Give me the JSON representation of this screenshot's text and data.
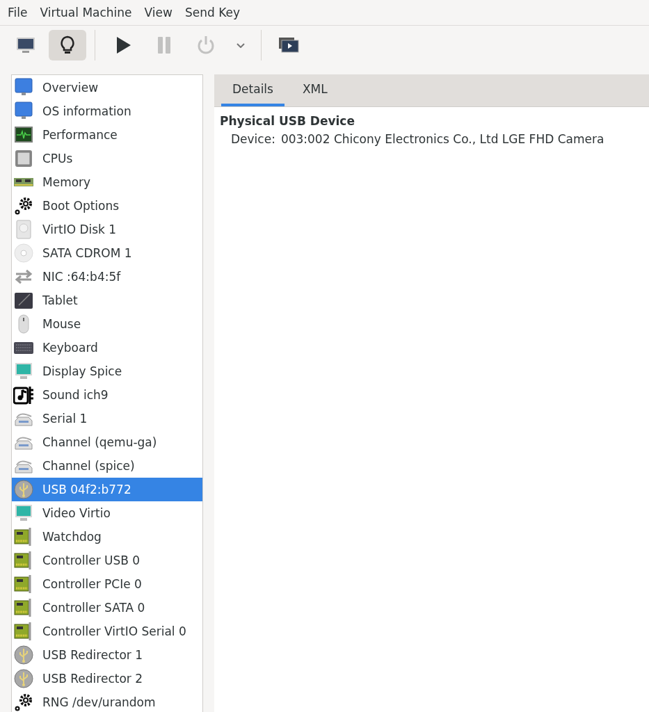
{
  "menu": [
    "File",
    "Virtual Machine",
    "View",
    "Send Key"
  ],
  "toolbar": [
    {
      "kind": "console",
      "selected": false,
      "disabled": false
    },
    {
      "kind": "details",
      "selected": true,
      "disabled": false
    },
    {
      "kind": "separator"
    },
    {
      "kind": "run",
      "selected": false,
      "disabled": false
    },
    {
      "kind": "pause",
      "selected": false,
      "disabled": true
    },
    {
      "kind": "shutdown",
      "selected": false,
      "disabled": true
    },
    {
      "kind": "dropdown",
      "selected": false,
      "disabled": false
    },
    {
      "kind": "separator"
    },
    {
      "kind": "fullscreen",
      "selected": false,
      "disabled": false
    }
  ],
  "sidebar": {
    "items": [
      {
        "label": "Overview",
        "kind": "monitor",
        "selected": false
      },
      {
        "label": "OS information",
        "kind": "monitor",
        "selected": false
      },
      {
        "label": "Performance",
        "kind": "performance",
        "selected": false
      },
      {
        "label": "CPUs",
        "kind": "cpu",
        "selected": false
      },
      {
        "label": "Memory",
        "kind": "memory",
        "selected": false
      },
      {
        "label": "Boot Options",
        "kind": "gears",
        "selected": false
      },
      {
        "label": "VirtIO Disk 1",
        "kind": "disk",
        "selected": false
      },
      {
        "label": "SATA CDROM 1",
        "kind": "cdrom",
        "selected": false
      },
      {
        "label": "NIC :64:b4:5f",
        "kind": "nic",
        "selected": false
      },
      {
        "label": "Tablet",
        "kind": "tablet",
        "selected": false
      },
      {
        "label": "Mouse",
        "kind": "mouse",
        "selected": false
      },
      {
        "label": "Keyboard",
        "kind": "keyboard",
        "selected": false
      },
      {
        "label": "Display Spice",
        "kind": "display",
        "selected": false
      },
      {
        "label": "Sound ich9",
        "kind": "sound",
        "selected": false
      },
      {
        "label": "Serial 1",
        "kind": "serial",
        "selected": false
      },
      {
        "label": "Channel (qemu-ga)",
        "kind": "serial",
        "selected": false
      },
      {
        "label": "Channel (spice)",
        "kind": "serial",
        "selected": false
      },
      {
        "label": "USB 04f2:b772",
        "kind": "usb",
        "selected": true
      },
      {
        "label": "Video Virtio",
        "kind": "display",
        "selected": false
      },
      {
        "label": "Watchdog",
        "kind": "card",
        "selected": false
      },
      {
        "label": "Controller USB 0",
        "kind": "card",
        "selected": false
      },
      {
        "label": "Controller PCIe 0",
        "kind": "card",
        "selected": false
      },
      {
        "label": "Controller SATA 0",
        "kind": "card",
        "selected": false
      },
      {
        "label": "Controller VirtIO Serial 0",
        "kind": "card",
        "selected": false
      },
      {
        "label": "USB Redirector 1",
        "kind": "usb",
        "selected": false
      },
      {
        "label": "USB Redirector 2",
        "kind": "usb",
        "selected": false
      },
      {
        "label": "RNG /dev/urandom",
        "kind": "gears",
        "selected": false
      }
    ]
  },
  "tabs": [
    {
      "label": "Details",
      "selected": true
    },
    {
      "label": "XML",
      "selected": false
    }
  ],
  "details": {
    "heading": "Physical USB Device",
    "fields": [
      {
        "label": "Device:",
        "value": "003:002 Chicony Electronics Co., Ltd LGE FHD Camera"
      }
    ]
  }
}
